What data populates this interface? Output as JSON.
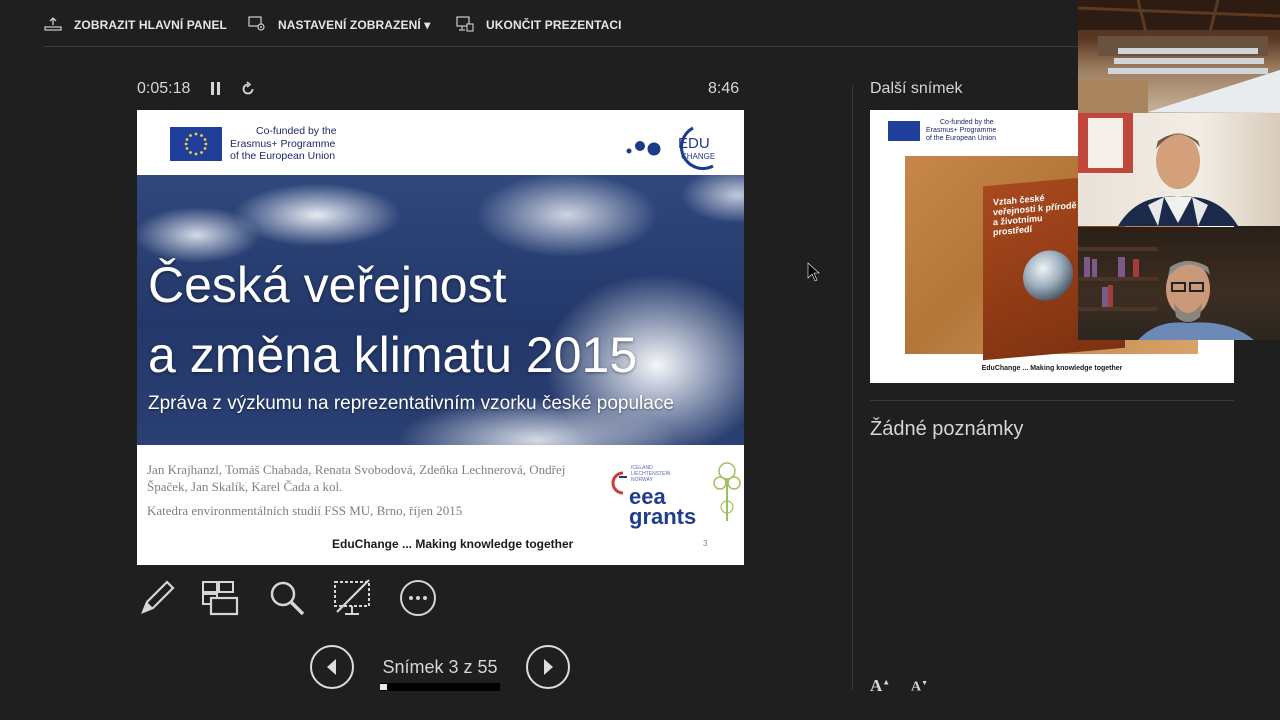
{
  "toolbar": {
    "show_taskbar": "ZOBRAZIT HLAVNÍ PANEL",
    "display_settings": "NASTAVENÍ ZOBRAZENÍ ▾",
    "end_show": "UKONČIT PREZENTACI"
  },
  "presenter": {
    "elapsed": "0:05:18",
    "clock": "8:46"
  },
  "slide": {
    "eu_text": [
      "Co-funded by the",
      "Erasmus+ Programme",
      "of the European Union"
    ],
    "edu_logo_text": "EDU",
    "edu_logo_sub": "CHANGE",
    "title_line1": "Česká veřejnost",
    "title_line2": "a změna klimatu 2015",
    "subtitle": "Zpráva z výzkumu na reprezentativním vzorku české populace",
    "authors": "Jan Krajhanzl, Tomáš Chabada, Renata Svobodová, Zdeňka Lechnerová, Ondřej Špaček, Jan Skalík, Karel Čada a kol.",
    "department": "Katedra environmentálních studií FSS MU, Brno, říjen 2015",
    "tagline": "EduChange ... Making knowledge together",
    "page_number": "3",
    "eea_small": [
      "ICELAND",
      "LIECHTENSTEIN",
      "NORWAY"
    ],
    "eea_line1": "eea",
    "eea_line2": "grants"
  },
  "navigation": {
    "slide_counter": "Snímek 3 z 55",
    "progress_fraction": 0.0545
  },
  "next_slide": {
    "label": "Další snímek",
    "eu_text": [
      "Co-funded by the",
      "Erasmus+ Programme",
      "of the European Union"
    ],
    "book_title": "Vztah české veřejnosti k přírodě a životnímu prostředí",
    "tagline": "EduChange ... Making knowledge together"
  },
  "notes": {
    "text": "Žádné poznámky"
  },
  "font_controls": {
    "increase": "A",
    "decrease": "A"
  },
  "icons": {
    "tools": [
      "pen-icon",
      "slides-grid-icon",
      "zoom-icon",
      "screen-off-icon",
      "more-options-icon"
    ],
    "nav": [
      "previous-slide-icon",
      "next-slide-icon"
    ]
  },
  "colors": {
    "background": "#1f1f1f",
    "eu_blue": "#1f3f9a",
    "eea_blue": "#203c8e",
    "text_light": "#d6d6d6"
  }
}
